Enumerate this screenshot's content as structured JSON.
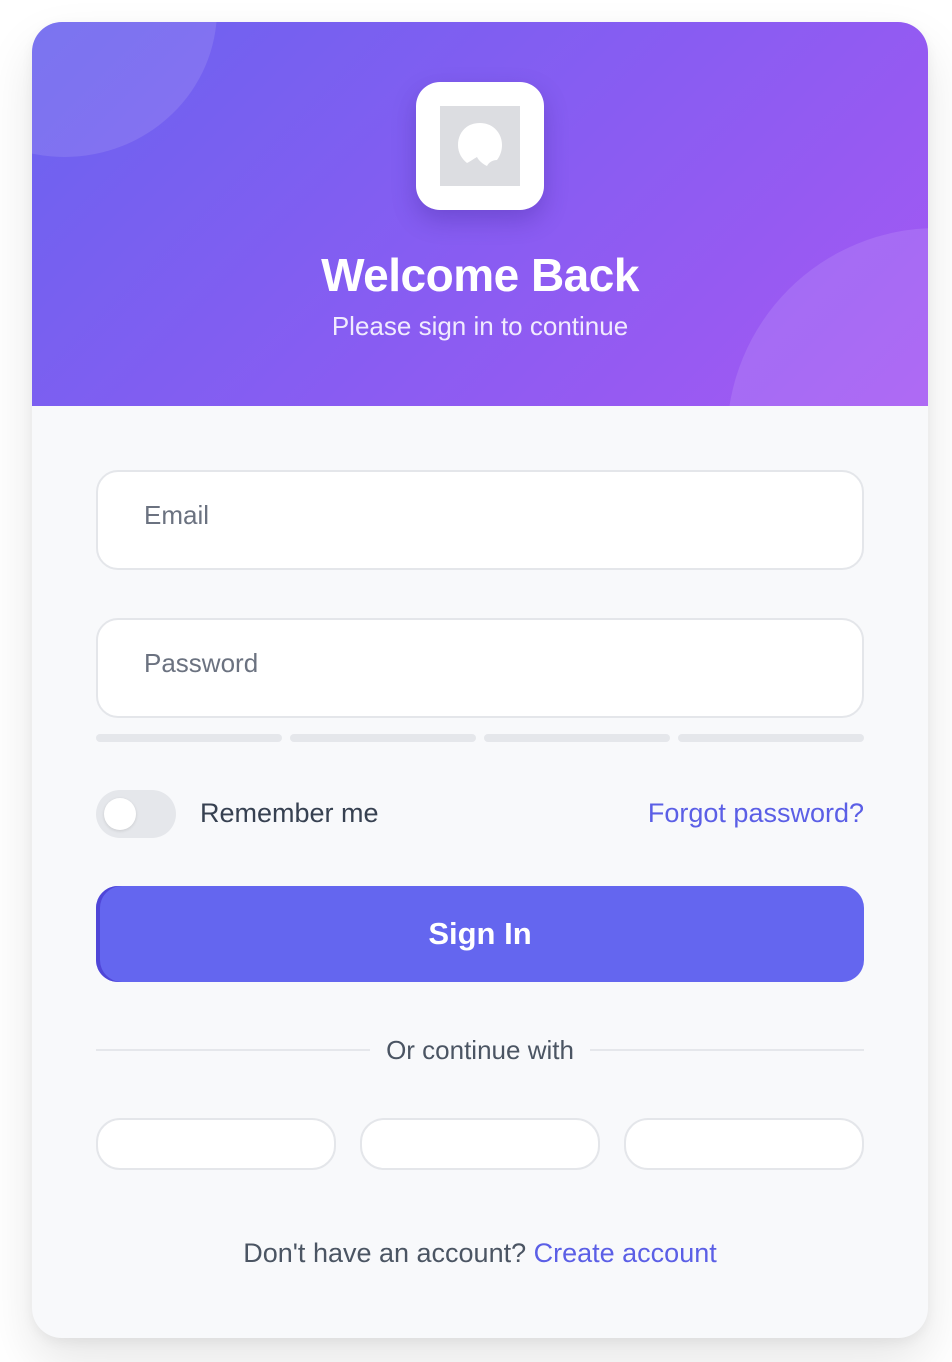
{
  "header": {
    "title": "Welcome Back",
    "subtitle": "Please sign in to continue",
    "gradient_start": "#6a63ef",
    "gradient_end": "#a558f3"
  },
  "logo": {
    "icon": "image-placeholder-icon"
  },
  "form": {
    "email": {
      "placeholder": "Email",
      "value": ""
    },
    "password": {
      "placeholder": "Password",
      "value": ""
    },
    "password_strength": {
      "segments": 4,
      "filled": 0
    },
    "remember": {
      "label": "Remember me",
      "checked": false
    },
    "forgot_label": "Forgot password?",
    "signin_label": "Sign In",
    "accent_color": "#6466ef"
  },
  "divider": {
    "label": "Or continue with"
  },
  "social_buttons": [
    {
      "label": ""
    },
    {
      "label": ""
    },
    {
      "label": ""
    }
  ],
  "footer": {
    "prompt": "Don't have an account?",
    "link_label": "Create account"
  }
}
